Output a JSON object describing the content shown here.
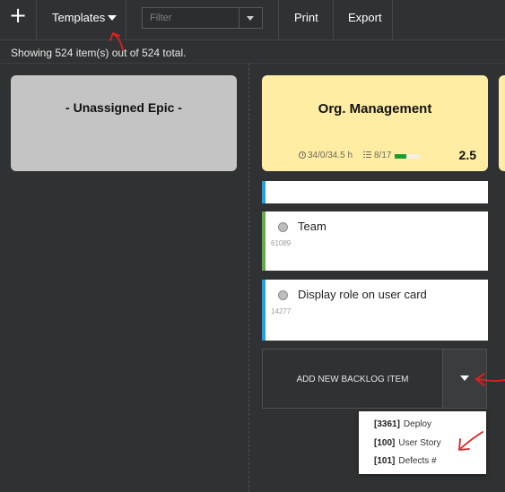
{
  "toolbar": {
    "add_label": "+",
    "templates_label": "Templates",
    "filter_placeholder": "Filter",
    "print_label": "Print",
    "export_label": "Export"
  },
  "status": {
    "text": "Showing 524 item(s) out of 524 total."
  },
  "epics": [
    {
      "title": "- Unassigned Epic -",
      "color": "#c4c4c4"
    },
    {
      "title": "Org. Management",
      "color": "#ffeda4",
      "hours": "34/0/34.5 h",
      "tasks": "8/17",
      "progress": 0.47,
      "score": "2.5"
    }
  ],
  "backlog_items": [
    {
      "title": "",
      "id": "",
      "accent": "#2a9fd6"
    },
    {
      "title": "Team",
      "id": "61089",
      "accent": "#6aa84f"
    },
    {
      "title": "Display role on user card",
      "id": "14277",
      "accent": "#2a9fd6"
    }
  ],
  "add_backlog": {
    "label": "ADD NEW BACKLOG ITEM"
  },
  "templates_menu": [
    {
      "id": "[3361]",
      "name": "Deploy"
    },
    {
      "id": "[100]",
      "name": "User Story"
    },
    {
      "id": "[101]",
      "name": "Defects #"
    }
  ],
  "colors": {
    "background": "#2f3132",
    "annotation": "#e02020",
    "progress_fill": "#1a9e2e"
  }
}
